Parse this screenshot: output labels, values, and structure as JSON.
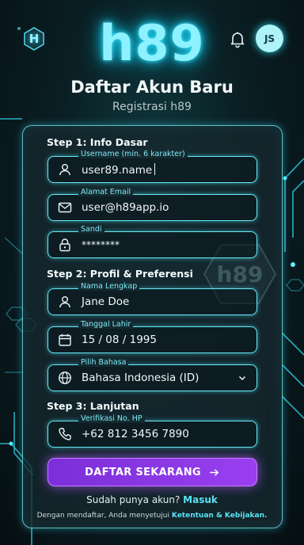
{
  "header": {
    "logo_letter": "H",
    "brand": "h89",
    "avatar_initials": "JS"
  },
  "page": {
    "title": "Daftar Akun Baru",
    "subtitle": "Registrasi h89",
    "watermark": "h89"
  },
  "steps": {
    "step1": "Step 1: Info Dasar",
    "step2": "Step 2: Profil & Preferensi",
    "step3": "Step 3: Lanjutan"
  },
  "fields": {
    "username": {
      "label": "Username (min. 6 karakter)",
      "value": "user89.name"
    },
    "email": {
      "label": "Alamat Email",
      "value": "user@h89app.io"
    },
    "password": {
      "label": "Sandi",
      "value": "********"
    },
    "fullname": {
      "label": "Nama Lengkap",
      "value": "Jane Doe"
    },
    "birthdate": {
      "label": "Tanggal Lahir",
      "value": "15 / 08 / 1995"
    },
    "language": {
      "label": "Pilih Bahasa",
      "value": "Bahasa Indonesia (ID)"
    },
    "phone": {
      "label": "Verifikasi No. HP",
      "value": "+62 812 3456 7890"
    }
  },
  "actions": {
    "submit_label": "DAFTAR SEKARANG",
    "login_prompt": "Sudah punya akun?",
    "login_link": "Masuk",
    "terms_text": "Dengan mendaftar, Anda menyetujui",
    "terms_link": "Ketentuan & Kebijakan."
  },
  "icons": {
    "logo": "hexagon-h-icon",
    "bell": "bell-icon",
    "user": "user-icon",
    "mail": "mail-icon",
    "lock": "lock-icon",
    "calendar": "calendar-icon",
    "globe": "globe-icon",
    "phone": "phone-icon",
    "chevron": "chevron-down-icon",
    "arrow": "arrow-right-icon"
  },
  "colors": {
    "accent_cyan": "#66eaf7",
    "button_purple": "#8a36e6",
    "background": "#0a1f24"
  }
}
